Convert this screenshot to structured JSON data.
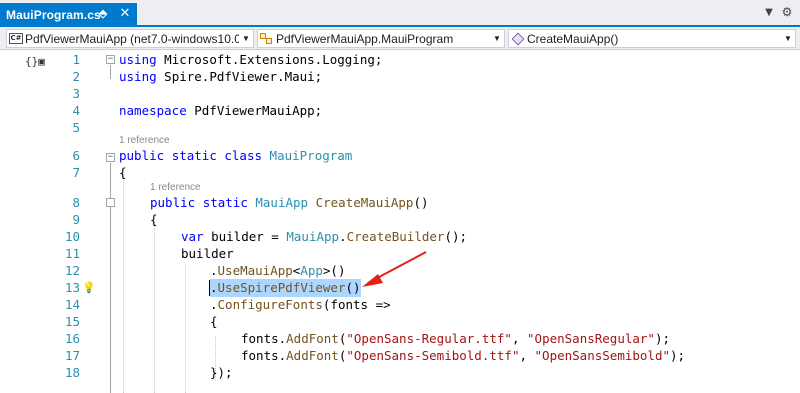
{
  "tab": {
    "title": "MauiProgram.cs*",
    "pin_icon": "pin-icon",
    "close_icon": "close-icon"
  },
  "navbar": {
    "project": "PdfViewerMauiApp (net7.0-windows10.0",
    "class": "PdfViewerMauiApp.MauiProgram",
    "member": "CreateMauiApp()"
  },
  "code_lens": {
    "class_refs": "1 reference",
    "method_refs": "1 reference"
  },
  "line_numbers": [
    "1",
    "2",
    "3",
    "4",
    "5",
    "6",
    "7",
    "8",
    "9",
    "10",
    "11",
    "12",
    "13",
    "14",
    "15",
    "16",
    "17",
    "18"
  ],
  "code": {
    "l1": {
      "kw": "using",
      "rest": " Microsoft.Extensions.Logging;"
    },
    "l2": {
      "kw": "using",
      "rest": " Spire.PdfViewer.Maui;"
    },
    "l4": {
      "kw": "namespace",
      "rest": " PdfViewerMauiApp;"
    },
    "l6": {
      "kw1": "public",
      "kw2": "static",
      "kw3": "class",
      "ty": "MauiProgram"
    },
    "l7": {
      "text": "{"
    },
    "l8": {
      "kw1": "public",
      "kw2": "static",
      "ty": "MauiApp",
      "mt": "CreateMauiApp",
      "rest": "()"
    },
    "l9": {
      "text": "{"
    },
    "l10": {
      "kw": "var",
      "mid": " builder = ",
      "ty": "MauiApp",
      "dot": ".",
      "mt": "CreateBuilder",
      "rest": "();"
    },
    "l11": {
      "text": "builder"
    },
    "l12": {
      "dot": ".",
      "mt": "UseMauiApp",
      "lt": "<",
      "ty": "App",
      "rest": ">()"
    },
    "l13": {
      "dot": ".",
      "mt": "UseSpirePdfViewer",
      "rest": "()"
    },
    "l14": {
      "dot": ".",
      "mt": "ConfigureFonts",
      "rest": "(fonts =>"
    },
    "l15": {
      "text": "{"
    },
    "l16": {
      "pre": "fonts.",
      "mt": "AddFont",
      "open": "(",
      "s1": "\"OpenSans-Regular.ttf\"",
      "comma": ", ",
      "s2": "\"OpenSansRegular\"",
      "close": ");"
    },
    "l17": {
      "pre": "fonts.",
      "mt": "AddFont",
      "open": "(",
      "s1": "\"OpenSans-Semibold.ttf\"",
      "comma": ", ",
      "s2": "\"OpenSansSemibold\"",
      "close": ");"
    },
    "l18": {
      "text": "});"
    }
  },
  "colors": {
    "keyword": "#0000ff",
    "type": "#2b91af",
    "string": "#a31515",
    "method": "#74531f",
    "line_number": "#2b91af",
    "selection": "#add6ff",
    "active_tab": "#007acc",
    "annotation_arrow": "#e8201b"
  },
  "icons": {
    "top_left": "file-structure-icon",
    "lightbulb": "lightbulb-icon",
    "project": "csharp-project-icon",
    "class": "class-icon",
    "method": "method-icon"
  }
}
